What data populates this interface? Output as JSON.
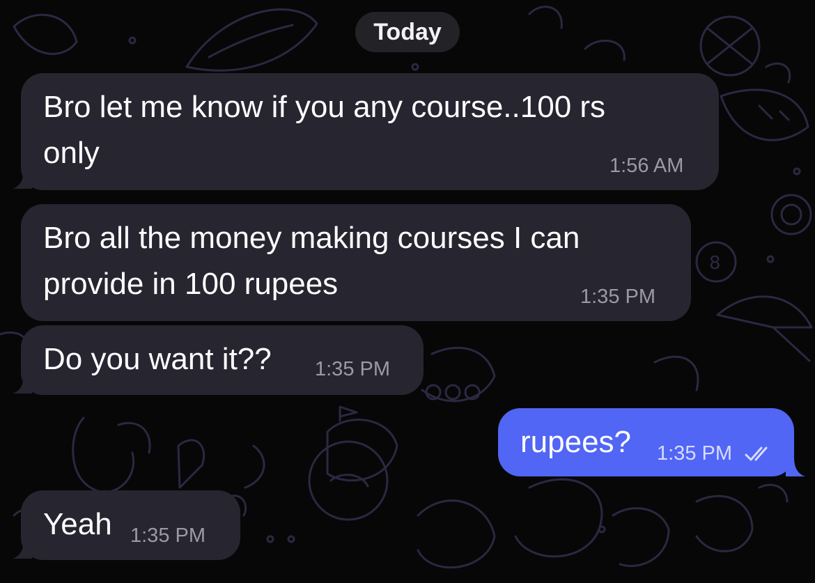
{
  "date_divider": "Today",
  "messages": [
    {
      "direction": "incoming",
      "lines": [
        "Bro let me know if you any course..100 rs",
        "only"
      ],
      "time": "1:56 AM"
    },
    {
      "direction": "incoming",
      "lines": [
        "Bro all the money making courses I can",
        "provide in 100 rupees"
      ],
      "time": "1:35 PM"
    },
    {
      "direction": "incoming",
      "lines": [
        "Do you want it??"
      ],
      "time": "1:35 PM"
    },
    {
      "direction": "outgoing",
      "lines": [
        "rupees?"
      ],
      "time": "1:35 PM",
      "status_icon": "double-check-icon"
    },
    {
      "direction": "incoming",
      "lines": [
        "Yeah"
      ],
      "time": "1:35 PM"
    }
  ],
  "colors": {
    "background": "#070707",
    "incoming_bubble": "#262530",
    "outgoing_bubble": "#5166f4",
    "time_incoming": "#9d9aa7",
    "time_outgoing": "#d8dcff"
  }
}
